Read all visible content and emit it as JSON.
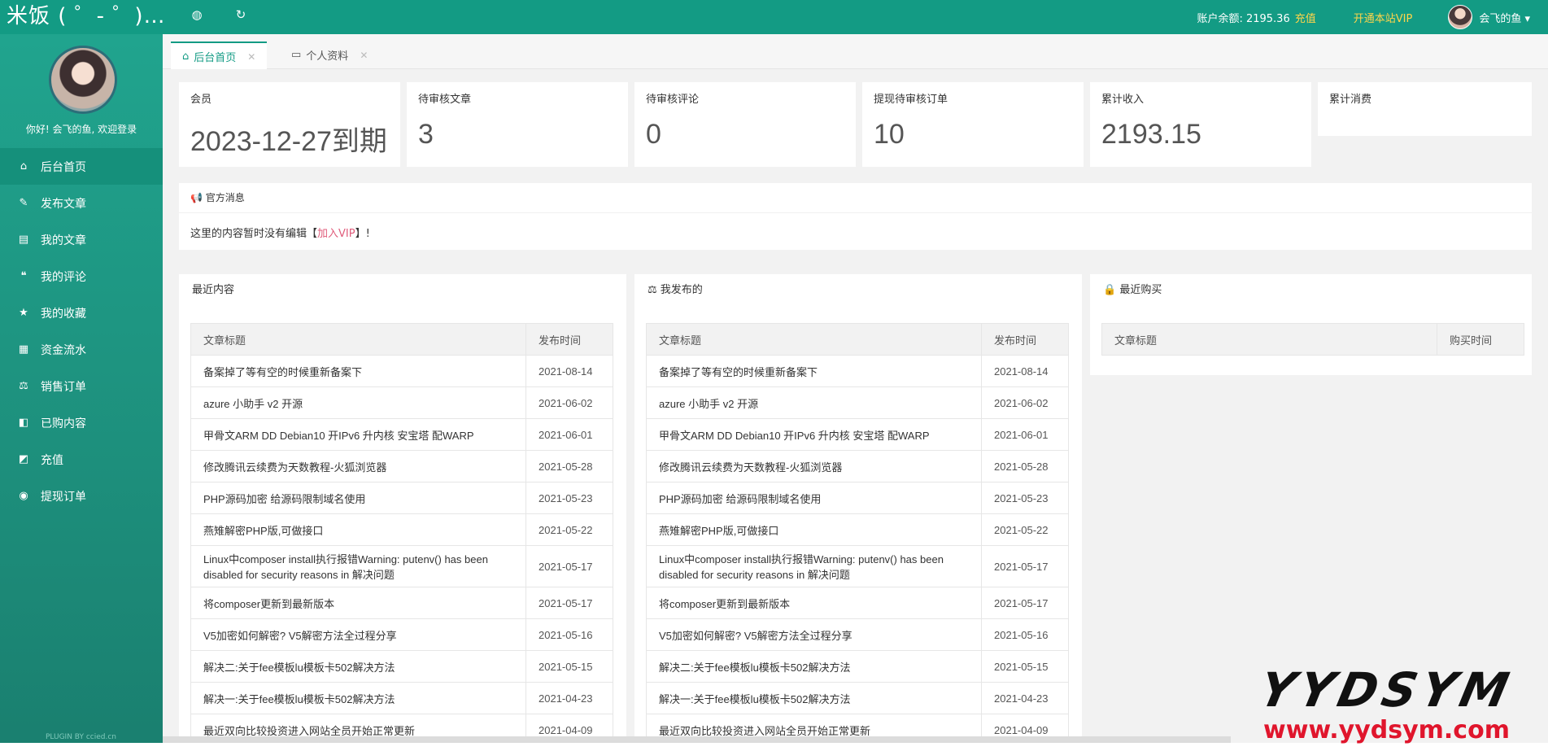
{
  "header": {
    "brand": "米饭 ( ゜- ゜)…",
    "balance_label": "账户余额: 2195.36",
    "recharge": "充值",
    "vip": "开通本站VIP",
    "username": "会飞的鱼 ▾",
    "icons": [
      "globe-icon",
      "refresh-icon"
    ]
  },
  "sidebar": {
    "greeting": "你好! 会飞的鱼, 欢迎登录",
    "items": [
      {
        "label": "后台首页",
        "icon": "⌂"
      },
      {
        "label": "发布文章",
        "icon": "✎"
      },
      {
        "label": "我的文章",
        "icon": "▤"
      },
      {
        "label": "我的评论",
        "icon": "❝"
      },
      {
        "label": "我的收藏",
        "icon": "★"
      },
      {
        "label": "资金流水",
        "icon": "▦"
      },
      {
        "label": "销售订单",
        "icon": "⚖"
      },
      {
        "label": "已购内容",
        "icon": "◧"
      },
      {
        "label": "充值",
        "icon": "◩"
      },
      {
        "label": "提现订单",
        "icon": "◉"
      }
    ],
    "plugin": "PLUGIN BY ccied.cn"
  },
  "tabs": [
    {
      "label": "后台首页",
      "icon": "⌂"
    },
    {
      "label": "个人资料",
      "icon": "▭"
    }
  ],
  "stats": [
    {
      "label": "会员",
      "value": "2023-12-27到期"
    },
    {
      "label": "待审核文章",
      "value": "3"
    },
    {
      "label": "待审核评论",
      "value": "0"
    },
    {
      "label": "提现待审核订单",
      "value": "10"
    },
    {
      "label": "累计收入",
      "value": "2193.15"
    },
    {
      "label": "累计消费",
      "value": ""
    }
  ],
  "notice": {
    "title": "官方消息",
    "text_before": "这里的内容暂时没有编辑【",
    "link": "加入VIP",
    "text_after": "】!"
  },
  "recent": {
    "title": "最近内容",
    "col_title": "文章标题",
    "col_date": "发布时间",
    "rows": [
      {
        "title": "备案掉了等有空的时候重新备案下",
        "date": "2021-08-14"
      },
      {
        "title": "azure 小助手 v2 开源",
        "date": "2021-06-02"
      },
      {
        "title": "甲骨文ARM DD Debian10 开IPv6 升内核 安宝塔 配WARP",
        "date": "2021-06-01"
      },
      {
        "title": "修改腾讯云续费为天数教程-火狐浏览器",
        "date": "2021-05-28"
      },
      {
        "title": "PHP源码加密 给源码限制域名使用",
        "date": "2021-05-23"
      },
      {
        "title": "燕雉解密PHP版,可做接口",
        "date": "2021-05-22"
      },
      {
        "title": "Linux中composer install执行报错Warning: putenv() has been disabled for security reasons in 解决问题",
        "date": "2021-05-17"
      },
      {
        "title": "将composer更新到最新版本",
        "date": "2021-05-17"
      },
      {
        "title": "V5加密如何解密? V5解密方法全过程分享",
        "date": "2021-05-16"
      },
      {
        "title": "解决二:关于fee模板lu模板卡502解决方法",
        "date": "2021-05-15"
      },
      {
        "title": "解决一:关于fee模板lu模板卡502解决方法",
        "date": "2021-04-23"
      },
      {
        "title": "最近双向比较投资进入网站全员开始正常更新",
        "date": "2021-04-09"
      }
    ]
  },
  "published": {
    "title": "我发布的",
    "col_title": "文章标题",
    "col_date": "发布时间",
    "rows": [
      {
        "title": "备案掉了等有空的时候重新备案下",
        "date": "2021-08-14"
      },
      {
        "title": "azure 小助手 v2 开源",
        "date": "2021-06-02"
      },
      {
        "title": "甲骨文ARM DD Debian10 开IPv6 升内核 安宝塔 配WARP",
        "date": "2021-06-01"
      },
      {
        "title": "修改腾讯云续费为天数教程-火狐浏览器",
        "date": "2021-05-28"
      },
      {
        "title": "PHP源码加密 给源码限制域名使用",
        "date": "2021-05-23"
      },
      {
        "title": "燕雉解密PHP版,可做接口",
        "date": "2021-05-22"
      },
      {
        "title": "Linux中composer install执行报错Warning: putenv() has been disabled for security reasons in 解决问题",
        "date": "2021-05-17"
      },
      {
        "title": "将composer更新到最新版本",
        "date": "2021-05-17"
      },
      {
        "title": "V5加密如何解密? V5解密方法全过程分享",
        "date": "2021-05-16"
      },
      {
        "title": "解决二:关于fee模板lu模板卡502解决方法",
        "date": "2021-05-15"
      },
      {
        "title": "解决一:关于fee模板lu模板卡502解决方法",
        "date": "2021-04-23"
      },
      {
        "title": "最近双向比较投资进入网站全员开始正常更新",
        "date": "2021-04-09"
      }
    ]
  },
  "purchases": {
    "title": "最近购买",
    "col_title": "文章标题",
    "col_date": "购买时间"
  },
  "watermark": {
    "big": "YYDSYM",
    "url": "www.yydsym.com"
  },
  "colors": {
    "primary": "#139b84",
    "vip": "#ffd54a",
    "link": "#e05c7b"
  }
}
